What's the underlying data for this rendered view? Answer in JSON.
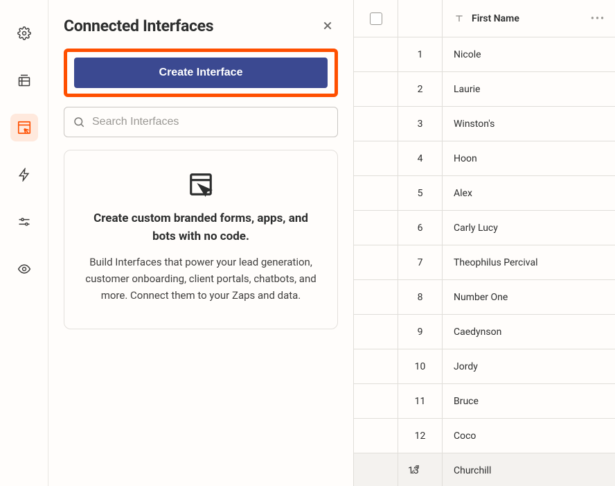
{
  "rail": {
    "items": [
      {
        "name": "settings-icon"
      },
      {
        "name": "tables-icon"
      },
      {
        "name": "interfaces-icon",
        "active": true
      },
      {
        "name": "automations-icon"
      },
      {
        "name": "filters-icon"
      },
      {
        "name": "views-icon"
      }
    ]
  },
  "panel": {
    "title": "Connected Interfaces",
    "create_label": "Create Interface",
    "search_placeholder": "Search Interfaces",
    "card": {
      "heading": "Create custom branded forms, apps, and bots with no code.",
      "body": "Build Interfaces that power your lead generation, customer onboarding, client portals, chatbots, and more. Connect them to your Zaps and data."
    }
  },
  "table": {
    "column_header": "First Name",
    "rows": [
      {
        "num": "1",
        "name": "Nicole"
      },
      {
        "num": "2",
        "name": "Laurie"
      },
      {
        "num": "3",
        "name": "Winston's"
      },
      {
        "num": "4",
        "name": "Hoon"
      },
      {
        "num": "5",
        "name": "Alex"
      },
      {
        "num": "6",
        "name": "Carly Lucy"
      },
      {
        "num": "7",
        "name": "Theophilus Percival"
      },
      {
        "num": "8",
        "name": "Number One"
      },
      {
        "num": "9",
        "name": "Caedynson"
      },
      {
        "num": "10",
        "name": "Jordy"
      },
      {
        "num": "11",
        "name": "Bruce"
      },
      {
        "num": "12",
        "name": "Coco"
      },
      {
        "num": "13",
        "name": "Churchill",
        "highlight": true
      }
    ]
  }
}
